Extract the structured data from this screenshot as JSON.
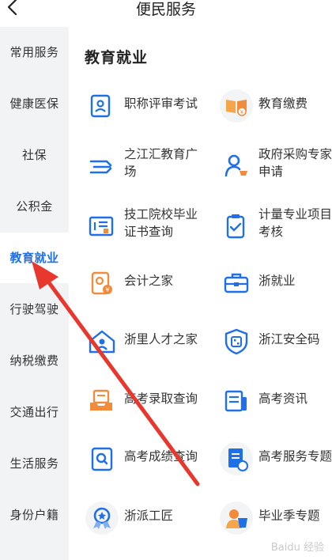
{
  "header": {
    "title": "便民服务"
  },
  "sidebar": {
    "items": [
      {
        "label": "常用服务"
      },
      {
        "label": "健康医保"
      },
      {
        "label": "社保"
      },
      {
        "label": "公积金"
      },
      {
        "label": "教育就业"
      },
      {
        "label": "行驶驾驶"
      },
      {
        "label": "纳税缴费"
      },
      {
        "label": "交通出行"
      },
      {
        "label": "生活服务"
      },
      {
        "label": "身份户籍"
      }
    ],
    "active_index": 4
  },
  "section": {
    "title": "教育就业"
  },
  "services": [
    {
      "label": "职称评审考试"
    },
    {
      "label": "教育缴费"
    },
    {
      "label": "之江汇教育广\n场"
    },
    {
      "label": "政府采购专家\n申请"
    },
    {
      "label": "技工院校毕业\n证书查询"
    },
    {
      "label": "计量专业项目\n考核"
    },
    {
      "label": "会计之家"
    },
    {
      "label": "浙就业"
    },
    {
      "label": "浙里人才之家"
    },
    {
      "label": "浙江安全码"
    },
    {
      "label": "高考录取查询"
    },
    {
      "label": "高考资讯"
    },
    {
      "label": "高考成绩查询"
    },
    {
      "label": "高考服务专题"
    },
    {
      "label": "浙派工匠"
    },
    {
      "label": "毕业季专题"
    }
  ],
  "watermark": "Baidu 经验",
  "colors": {
    "accent": "#1e6fe8",
    "orange": "#f08c3c",
    "arrow": "#e8372c",
    "sidebar_bg": "#f2f3f5"
  }
}
